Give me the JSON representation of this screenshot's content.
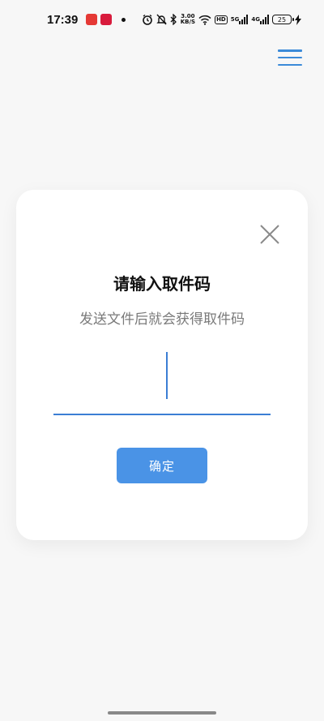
{
  "status_bar": {
    "time": "17:39",
    "app_badge_1": "",
    "app_badge_2": "",
    "net_speed_value": "3.00",
    "net_speed_unit": "KB/S",
    "hd_label": "HD",
    "signal_1_label": "5G",
    "signal_2_label": "4G",
    "battery_level": "25"
  },
  "header": {
    "menu_icon": "hamburger-menu-icon"
  },
  "dialog": {
    "close_icon": "close-icon",
    "title": "请输入取件码",
    "subtitle": "发送文件后就会获得取件码",
    "code_value": "",
    "confirm_label": "确定"
  },
  "colors": {
    "accent": "#4a93e6",
    "underline": "#3b7ed4",
    "background": "#f7f7f7"
  }
}
